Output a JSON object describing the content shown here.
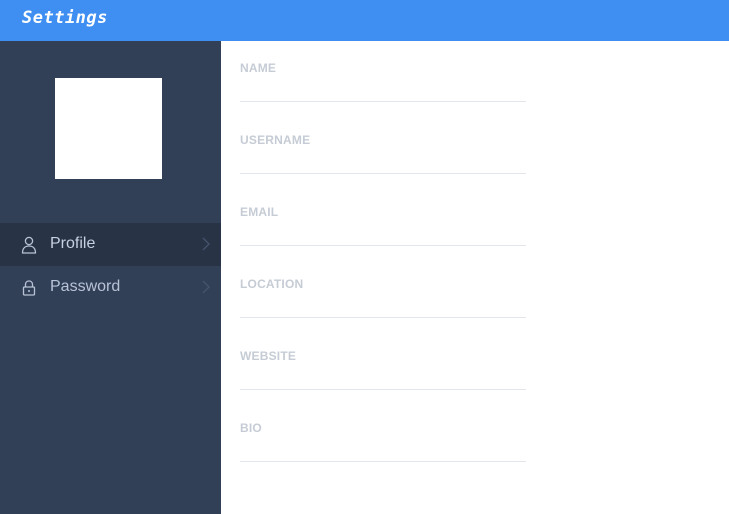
{
  "header": {
    "title": "Settings",
    "background": "#3f8ef1"
  },
  "sidebar": {
    "background": "#313f57",
    "avatar": {
      "icon": "avatar-placeholder"
    },
    "items": [
      {
        "label": "Profile",
        "icon": "user-icon",
        "active": true
      },
      {
        "label": "Password",
        "icon": "lock-icon",
        "active": false
      }
    ]
  },
  "form": {
    "fields": [
      {
        "label": "NAME",
        "value": ""
      },
      {
        "label": "USERNAME",
        "value": ""
      },
      {
        "label": "EMAIL",
        "value": ""
      },
      {
        "label": "LOCATION",
        "value": ""
      },
      {
        "label": "WEBSITE",
        "value": ""
      },
      {
        "label": "BIO",
        "value": ""
      }
    ]
  }
}
